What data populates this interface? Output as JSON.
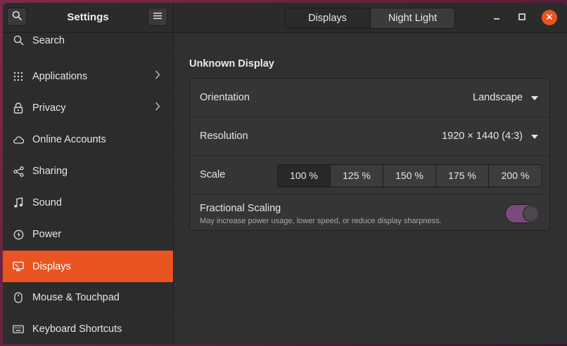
{
  "header": {
    "title": "Settings",
    "tabs": [
      {
        "label": "Displays"
      },
      {
        "label": "Night Light"
      }
    ]
  },
  "sidebar": {
    "items": [
      {
        "label": "Search",
        "icon": "search-icon"
      },
      {
        "label": "Applications",
        "icon": "grid-icon"
      },
      {
        "label": "Privacy",
        "icon": "lock-icon"
      },
      {
        "label": "Online Accounts",
        "icon": "cloud-icon"
      },
      {
        "label": "Sharing",
        "icon": "share-icon"
      },
      {
        "label": "Sound",
        "icon": "music-note-icon"
      },
      {
        "label": "Power",
        "icon": "power-icon"
      },
      {
        "label": "Displays",
        "icon": "display-icon",
        "active": true
      },
      {
        "label": "Mouse & Touchpad",
        "icon": "mouse-icon"
      },
      {
        "label": "Keyboard Shortcuts",
        "icon": "keyboard-icon"
      }
    ]
  },
  "main": {
    "section_title": "Unknown Display",
    "orientation": {
      "label": "Orientation",
      "value": "Landscape"
    },
    "resolution": {
      "label": "Resolution",
      "value": "1920 × 1440 (4:3)"
    },
    "scale": {
      "label": "Scale",
      "options": [
        "100 %",
        "125 %",
        "150 %",
        "175 %",
        "200 %"
      ],
      "selected": "100 %"
    },
    "fractional_scaling": {
      "label": "Fractional Scaling",
      "description": "May increase power usage, lower speed, or reduce display sharpness.",
      "enabled": true
    }
  },
  "colors": {
    "accent": "#e95420",
    "toggle_on": "#7a4a7e"
  }
}
